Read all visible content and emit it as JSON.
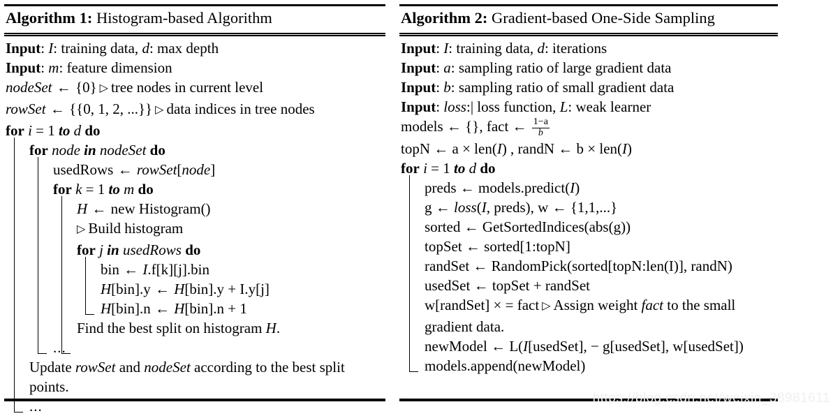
{
  "algorithm1": {
    "title_label": "Algorithm 1:",
    "title_text": "Histogram-based Algorithm",
    "lines": [
      {
        "id": "a1-input-1",
        "parts": [
          {
            "t": "Input",
            "s": "kw"
          },
          {
            "t": ": ",
            "s": "rm"
          },
          {
            "t": "I",
            "s": "mi"
          },
          {
            "t": ": training data, ",
            "s": "rm"
          },
          {
            "t": "d",
            "s": "mi"
          },
          {
            "t": ": max depth",
            "s": "rm"
          }
        ]
      },
      {
        "id": "a1-input-2",
        "parts": [
          {
            "t": "Input",
            "s": "kw"
          },
          {
            "t": ": ",
            "s": "rm"
          },
          {
            "t": "m",
            "s": "mi"
          },
          {
            "t": ": feature dimension",
            "s": "rm"
          }
        ]
      },
      {
        "id": "a1-nodeset-init",
        "parts": [
          {
            "t": "nodeSet",
            "s": "mi"
          },
          {
            "t": " ← ",
            "s": "arrow"
          },
          {
            "t": "{0}",
            "s": "rm"
          },
          {
            "t": " ▷ ",
            "s": "tri"
          },
          {
            "t": "tree nodes in current level",
            "s": "rm"
          }
        ]
      },
      {
        "id": "a1-rowset-init",
        "parts": [
          {
            "t": "rowSet",
            "s": "mi"
          },
          {
            "t": " ← ",
            "s": "arrow"
          },
          {
            "t": "{{0, 1, 2, ...}}",
            "s": "rm"
          },
          {
            "t": " ▷ ",
            "s": "tri"
          },
          {
            "t": "data indices in tree nodes",
            "s": "rm"
          }
        ]
      },
      {
        "id": "a1-for-i",
        "parts": [
          {
            "t": "for",
            "s": "kw"
          },
          {
            "t": " ",
            "s": "rm"
          },
          {
            "t": "i",
            "s": "mi"
          },
          {
            "t": " = 1 ",
            "s": "rm"
          },
          {
            "t": "to",
            "s": "kwi"
          },
          {
            "t": " ",
            "s": "rm"
          },
          {
            "t": "d",
            "s": "mi"
          },
          {
            "t": " ",
            "s": "rm"
          },
          {
            "t": "do",
            "s": "kw"
          }
        ]
      },
      {
        "id": "a1-for-node",
        "parts": [
          {
            "t": "for",
            "s": "kw"
          },
          {
            "t": " ",
            "s": "rm"
          },
          {
            "t": "node",
            "s": "mi"
          },
          {
            "t": " ",
            "s": "rm"
          },
          {
            "t": "in",
            "s": "kwi"
          },
          {
            "t": " ",
            "s": "rm"
          },
          {
            "t": "nodeSet",
            "s": "mi"
          },
          {
            "t": " ",
            "s": "rm"
          },
          {
            "t": "do",
            "s": "kw"
          }
        ]
      },
      {
        "id": "a1-usedrows",
        "parts": [
          {
            "t": "usedRows",
            "s": "rm"
          },
          {
            "t": " ← ",
            "s": "arrow"
          },
          {
            "t": "rowSet",
            "s": "mi"
          },
          {
            "t": "[",
            "s": "rm"
          },
          {
            "t": "node",
            "s": "mi"
          },
          {
            "t": "]",
            "s": "rm"
          }
        ]
      },
      {
        "id": "a1-for-k",
        "parts": [
          {
            "t": "for",
            "s": "kw"
          },
          {
            "t": " ",
            "s": "rm"
          },
          {
            "t": "k",
            "s": "mi"
          },
          {
            "t": " = 1 ",
            "s": "rm"
          },
          {
            "t": "to",
            "s": "kwi"
          },
          {
            "t": " ",
            "s": "rm"
          },
          {
            "t": "m",
            "s": "mi"
          },
          {
            "t": " ",
            "s": "rm"
          },
          {
            "t": "do",
            "s": "kw"
          }
        ]
      },
      {
        "id": "a1-new-histogram",
        "parts": [
          {
            "t": "H",
            "s": "mi"
          },
          {
            "t": " ← ",
            "s": "arrow"
          },
          {
            "t": "new   Histogram()",
            "s": "rm"
          }
        ]
      },
      {
        "id": "a1-build-histogram",
        "parts": [
          {
            "t": "▷ ",
            "s": "tri"
          },
          {
            "t": "Build histogram",
            "s": "rm"
          }
        ]
      },
      {
        "id": "a1-for-j",
        "parts": [
          {
            "t": "for",
            "s": "kw"
          },
          {
            "t": " ",
            "s": "rm"
          },
          {
            "t": "j",
            "s": "mi"
          },
          {
            "t": " ",
            "s": "rm"
          },
          {
            "t": "in",
            "s": "kwi"
          },
          {
            "t": " ",
            "s": "rm"
          },
          {
            "t": "usedRows",
            "s": "mi"
          },
          {
            "t": " ",
            "s": "rm"
          },
          {
            "t": "do",
            "s": "kw"
          }
        ]
      },
      {
        "id": "a1-bin-assign",
        "parts": [
          {
            "t": "bin",
            "s": "rm"
          },
          {
            "t": " ← ",
            "s": "arrow"
          },
          {
            "t": "I",
            "s": "mi"
          },
          {
            "t": ".f[k][j].bin",
            "s": "rm"
          }
        ]
      },
      {
        "id": "a1-hbin-y",
        "parts": [
          {
            "t": "H",
            "s": "mi"
          },
          {
            "t": "[bin].y",
            "s": "rm"
          },
          {
            "t": " ← ",
            "s": "arrow"
          },
          {
            "t": "H",
            "s": "mi"
          },
          {
            "t": "[bin].y + I.y[j]",
            "s": "rm"
          }
        ]
      },
      {
        "id": "a1-hbin-n",
        "parts": [
          {
            "t": "H",
            "s": "mi"
          },
          {
            "t": "[bin].n",
            "s": "rm"
          },
          {
            "t": " ← ",
            "s": "arrow"
          },
          {
            "t": "H",
            "s": "mi"
          },
          {
            "t": "[bin].n + 1",
            "s": "rm"
          }
        ]
      },
      {
        "id": "a1-find-best-split",
        "parts": [
          {
            "t": "Find the best split on histogram ",
            "s": "rm"
          },
          {
            "t": "H",
            "s": "mi"
          },
          {
            "t": ".",
            "s": "rm"
          }
        ]
      },
      {
        "id": "a1-ellipsis-inner",
        "parts": [
          {
            "t": "...",
            "s": "dots"
          }
        ]
      },
      {
        "id": "a1-update-sets",
        "parts": [
          {
            "t": "Update ",
            "s": "rm"
          },
          {
            "t": "rowSet",
            "s": "mi"
          },
          {
            "t": " and ",
            "s": "rm"
          },
          {
            "t": "nodeSet",
            "s": "mi"
          },
          {
            "t": " according to the best split points.",
            "s": "rm"
          }
        ]
      },
      {
        "id": "a1-ellipsis-outer",
        "parts": [
          {
            "t": "...",
            "s": "dots"
          }
        ]
      }
    ]
  },
  "algorithm2": {
    "title_label": "Algorithm 2:",
    "title_text": "Gradient-based One-Side Sampling",
    "lines": [
      {
        "id": "a2-input-1",
        "parts": [
          {
            "t": "Input",
            "s": "kw"
          },
          {
            "t": ": ",
            "s": "rm"
          },
          {
            "t": "I",
            "s": "mi"
          },
          {
            "t": ": training data, ",
            "s": "rm"
          },
          {
            "t": "d",
            "s": "mi"
          },
          {
            "t": ": iterations",
            "s": "rm"
          }
        ]
      },
      {
        "id": "a2-input-2",
        "parts": [
          {
            "t": "Input",
            "s": "kw"
          },
          {
            "t": ": ",
            "s": "rm"
          },
          {
            "t": "a",
            "s": "mi"
          },
          {
            "t": ": sampling ratio of large gradient data",
            "s": "rm"
          }
        ]
      },
      {
        "id": "a2-input-3",
        "parts": [
          {
            "t": "Input",
            "s": "kw"
          },
          {
            "t": ": ",
            "s": "rm"
          },
          {
            "t": "b",
            "s": "mi"
          },
          {
            "t": ": sampling ratio of small gradient data",
            "s": "rm"
          }
        ]
      },
      {
        "id": "a2-input-4",
        "parts": [
          {
            "t": "Input",
            "s": "kw"
          },
          {
            "t": ": ",
            "s": "rm"
          },
          {
            "t": "loss",
            "s": "mi"
          },
          {
            "t": ":| loss function, ",
            "s": "rm"
          },
          {
            "t": "L",
            "s": "mi"
          },
          {
            "t": ": weak learner",
            "s": "rm"
          }
        ]
      },
      {
        "id": "a2-models-fact",
        "parts": [
          {
            "t": "models ← {}, fact ← ",
            "s": "rm"
          }
        ],
        "fraction": {
          "numerator": "1−a",
          "denominator": "b"
        }
      },
      {
        "id": "a2-topn-randn",
        "parts": [
          {
            "t": "topN ← a × len(",
            "s": "rm"
          },
          {
            "t": "I",
            "s": "mi"
          },
          {
            "t": ") , randN ← b × len(",
            "s": "rm"
          },
          {
            "t": "I",
            "s": "mi"
          },
          {
            "t": ")",
            "s": "rm"
          }
        ]
      },
      {
        "id": "a2-for-i",
        "parts": [
          {
            "t": "for",
            "s": "kw"
          },
          {
            "t": " ",
            "s": "rm"
          },
          {
            "t": "i",
            "s": "mi"
          },
          {
            "t": " = 1 ",
            "s": "rm"
          },
          {
            "t": "to",
            "s": "kwi"
          },
          {
            "t": " ",
            "s": "rm"
          },
          {
            "t": "d",
            "s": "mi"
          },
          {
            "t": " ",
            "s": "rm"
          },
          {
            "t": "do",
            "s": "kw"
          }
        ]
      },
      {
        "id": "a2-preds",
        "parts": [
          {
            "t": "preds ← models.predict(",
            "s": "rm"
          },
          {
            "t": "I",
            "s": "mi"
          },
          {
            "t": ")",
            "s": "rm"
          }
        ]
      },
      {
        "id": "a2-gradients",
        "parts": [
          {
            "t": "g ← ",
            "s": "rm"
          },
          {
            "t": "loss",
            "s": "mi"
          },
          {
            "t": "(",
            "s": "rm"
          },
          {
            "t": "I",
            "s": "mi"
          },
          {
            "t": ", preds), w ← {1,1,...}",
            "s": "rm"
          }
        ]
      },
      {
        "id": "a2-sorted",
        "parts": [
          {
            "t": "sorted ← GetSortedIndices(abs(g))",
            "s": "rm"
          }
        ]
      },
      {
        "id": "a2-topset",
        "parts": [
          {
            "t": "topSet ← sorted[1:topN]",
            "s": "rm"
          }
        ]
      },
      {
        "id": "a2-randset",
        "parts": [
          {
            "t": "randSet ← RandomPick(sorted[topN:len(I)], randN)",
            "s": "rm"
          }
        ]
      },
      {
        "id": "a2-usedset",
        "parts": [
          {
            "t": "usedSet ← topSet + randSet",
            "s": "rm"
          }
        ]
      },
      {
        "id": "a2-weight-fact",
        "parts": [
          {
            "t": "w[randSet] × = fact",
            "s": "rm"
          },
          {
            "t": " ▷ ",
            "s": "tri"
          },
          {
            "t": "Assign weight ",
            "s": "rm"
          },
          {
            "t": "fact",
            "s": "mi"
          },
          {
            "t": " to the small gradient data.",
            "s": "rm"
          }
        ]
      },
      {
        "id": "a2-newmodel",
        "parts": [
          {
            "t": "newModel ← L(",
            "s": "rm"
          },
          {
            "t": "I",
            "s": "mi"
          },
          {
            "t": "[usedSet], − g[usedSet], w[usedSet])",
            "s": "rm"
          }
        ]
      },
      {
        "id": "a2-append-model",
        "parts": [
          {
            "t": "models.append(newModel)",
            "s": "rm"
          }
        ]
      }
    ]
  },
  "watermark": {
    "text": "https://blog.csdn.net/weixin_38981611"
  }
}
